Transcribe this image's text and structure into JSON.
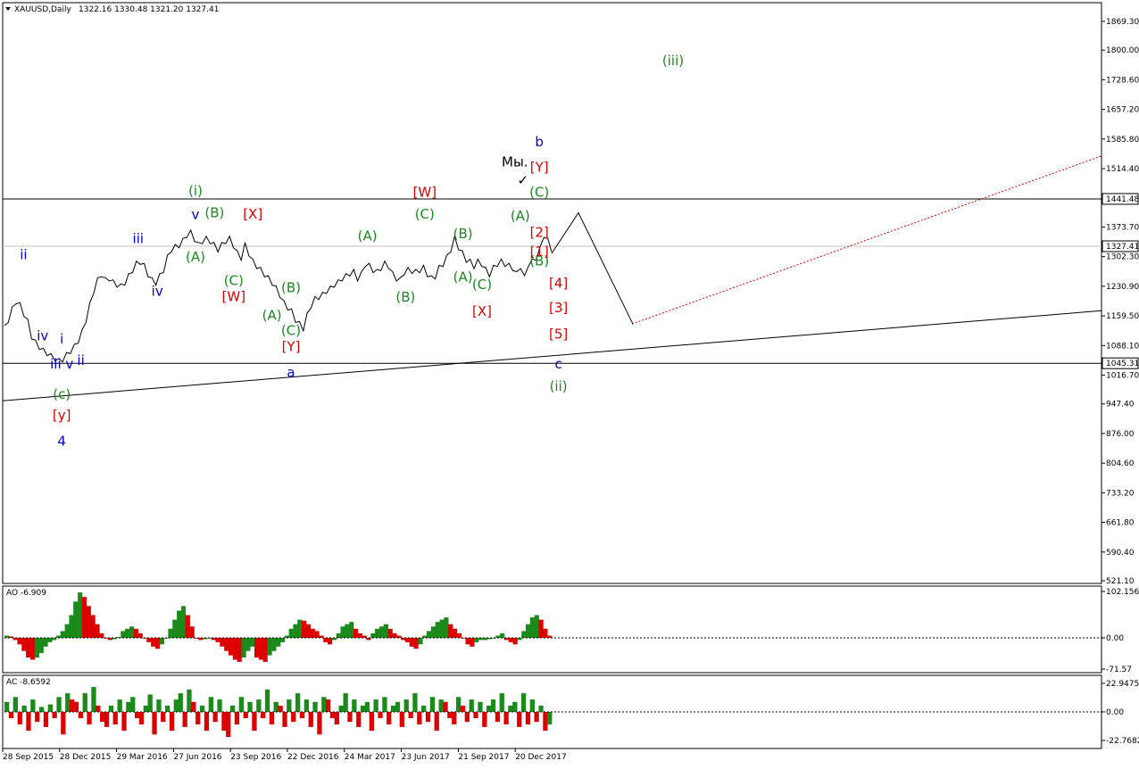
{
  "chart_data": {
    "type": "line",
    "header": {
      "symbol": "XAUUSD,Daily",
      "ohlc": "1322.16 1330.48 1321.20 1327.41"
    },
    "price_axis": {
      "ticks": [
        "1869.30",
        "1800.00",
        "1728.60",
        "1657.20",
        "1585.80",
        "1514.40",
        "1441.48",
        "1373.70",
        "1327.41",
        "1302.30",
        "1230.90",
        "1159.50",
        "1088.10",
        "1045.31",
        "1016.70",
        "947.40",
        "876.00",
        "804.60",
        "733.20",
        "661.80",
        "590.40",
        "521.10"
      ],
      "ylim": [
        521.1,
        1869.3
      ]
    },
    "time_axis": {
      "ticks": [
        "28 Sep 2015",
        "28 Dec 2015",
        "29 Mar 2016",
        "27 Jun 2016",
        "23 Sep 2016",
        "22 Dec 2016",
        "24 Mar 2017",
        "23 Jun 2017",
        "21 Sep 2017",
        "20 Dec 2017"
      ]
    },
    "price_series": {
      "name": "",
      "values": [
        1130,
        1150,
        1175,
        1195,
        1185,
        1165,
        1145,
        1110,
        1095,
        1085,
        1075,
        1070,
        1062,
        1058,
        1050,
        1055,
        1065,
        1075,
        1085,
        1100,
        1120,
        1150,
        1185,
        1220,
        1245,
        1260,
        1245,
        1250,
        1240,
        1235,
        1230,
        1240,
        1255,
        1270,
        1285,
        1290,
        1280,
        1260,
        1245,
        1240,
        1255,
        1270,
        1300,
        1320,
        1325,
        1330,
        1340,
        1355,
        1360,
        1345,
        1330,
        1340,
        1345,
        1340,
        1330,
        1320,
        1330,
        1340,
        1345,
        1330,
        1310,
        1300,
        1330,
        1310,
        1290,
        1280,
        1270,
        1260,
        1250,
        1240,
        1225,
        1210,
        1190,
        1180,
        1170,
        1150,
        1140,
        1130,
        1160,
        1185,
        1200,
        1205,
        1210,
        1220,
        1225,
        1235,
        1240,
        1250,
        1255,
        1262,
        1265,
        1250,
        1260,
        1285,
        1280,
        1270,
        1265,
        1275,
        1285,
        1280,
        1260,
        1250,
        1245,
        1265,
        1270,
        1268,
        1265,
        1270,
        1275,
        1260,
        1250,
        1255,
        1275,
        1285,
        1300,
        1320,
        1345,
        1325,
        1310,
        1295,
        1290,
        1280,
        1290,
        1285,
        1270,
        1260,
        1275,
        1285,
        1290,
        1285,
        1280,
        1275,
        1260,
        1280,
        1250,
        1285,
        1290,
        1300,
        1320,
        1355,
        1340,
        1320
      ],
      "stroke": "#000000"
    },
    "overlay_lines": {
      "resistance_level": 1441.48,
      "support_level": 1045.31,
      "current_price_level": 1327.41,
      "trendline": [
        {
          "date": "Sep 2015",
          "price": 955
        },
        {
          "date": "Jan 2019",
          "price": 1172
        }
      ],
      "dotted_projection": [
        {
          "date": "Feb 2018",
          "price": 1140
        },
        {
          "date": "Jan 2019",
          "price": 1545
        }
      ],
      "forecast_path": [
        {
          "date": "Dec 2017",
          "price": 1310
        },
        {
          "date": "Jan 2018",
          "price": 1408
        },
        {
          "date": "Feb 2018",
          "price": 1140
        }
      ]
    },
    "wave_labels": [
      {
        "text": "ii",
        "color": "#0000cc",
        "date": "Oct 2015",
        "price": 1306
      },
      {
        "text": "iv",
        "color": "#0000cc",
        "date": "Nov 2015",
        "price": 1110
      },
      {
        "text": "i",
        "color": "#0000cc",
        "date": "Dec 2015",
        "price": 1103
      },
      {
        "text": "iii v",
        "color": "#0000cc",
        "date": "Dec 2015",
        "price": 1042
      },
      {
        "text": "ii",
        "color": "#0000cc",
        "date": "Jan 2016",
        "price": 1051
      },
      {
        "text": "(c)",
        "color": "#1a8a1a",
        "date": "Dec 2015",
        "price": 969
      },
      {
        "text": "[y]",
        "color": "#dd0000",
        "date": "Dec 2015",
        "price": 919
      },
      {
        "text": "4",
        "color": "#0000cc",
        "date": "Dec 2015",
        "price": 856
      },
      {
        "text": "iii",
        "color": "#0000cc",
        "date": "Apr 2016",
        "price": 1345
      },
      {
        "text": "iv",
        "color": "#0000cc",
        "date": "May 2016",
        "price": 1218
      },
      {
        "text": "v",
        "color": "#0000cc",
        "date": "Jul 2016",
        "price": 1403
      },
      {
        "text": "(i)",
        "color": "#1a8a1a",
        "date": "Jul 2016",
        "price": 1460
      },
      {
        "text": "(A)",
        "color": "#1a8a1a",
        "date": "Jul 2016",
        "price": 1301
      },
      {
        "text": "(B)",
        "color": "#1a8a1a",
        "date": "Aug 2016",
        "price": 1407
      },
      {
        "text": "(C)",
        "color": "#1a8a1a",
        "date": "Sep 2016",
        "price": 1244
      },
      {
        "text": "[W]",
        "color": "#dd0000",
        "date": "Sep 2016",
        "price": 1205
      },
      {
        "text": "[X]",
        "color": "#dd0000",
        "date": "Oct 2016",
        "price": 1404
      },
      {
        "text": "(A)",
        "color": "#1a8a1a",
        "date": "Nov 2016",
        "price": 1160
      },
      {
        "text": "(B)",
        "color": "#1a8a1a",
        "date": "Dec 2016",
        "price": 1226
      },
      {
        "text": "(C)",
        "color": "#1a8a1a",
        "date": "Dec 2016",
        "price": 1123
      },
      {
        "text": "[Y]",
        "color": "#dd0000",
        "date": "Dec 2016",
        "price": 1084
      },
      {
        "text": "a",
        "color": "#0000cc",
        "date": "Dec 2016",
        "price": 1022
      },
      {
        "text": "(A)",
        "color": "#1a8a1a",
        "date": "Apr 2017",
        "price": 1351
      },
      {
        "text": "(B)",
        "color": "#1a8a1a",
        "date": "Jun 2017",
        "price": 1204
      },
      {
        "text": "[W]",
        "color": "#dd0000",
        "date": "Jul 2017",
        "price": 1456
      },
      {
        "text": "(C)",
        "color": "#1a8a1a",
        "date": "Jul 2017",
        "price": 1404
      },
      {
        "text": "(B)",
        "color": "#1a8a1a",
        "date": "Sep 2017",
        "price": 1357
      },
      {
        "text": "(A)",
        "color": "#1a8a1a",
        "date": "Sep 2017",
        "price": 1252
      },
      {
        "text": "(C)",
        "color": "#1a8a1a",
        "date": "Oct 2017",
        "price": 1234
      },
      {
        "text": "[X]",
        "color": "#dd0000",
        "date": "Oct 2017",
        "price": 1169
      },
      {
        "text": "(A)",
        "color": "#1a8a1a",
        "date": "Dec 2017",
        "price": 1399
      },
      {
        "text": "(B)",
        "color": "#1a8a1a",
        "date": "Jan 2018",
        "price": 1291
      },
      {
        "text": "(C)",
        "color": "#1a8a1a",
        "date": "Jan 2018",
        "price": 1456
      },
      {
        "text": "[Y]",
        "color": "#dd0000",
        "date": "Jan 2018",
        "price": 1517
      },
      {
        "text": "b",
        "color": "#0000cc",
        "date": "Jan 2018",
        "price": 1578
      },
      {
        "text": "[1]",
        "color": "#dd0000",
        "date": "Jan 2018",
        "price": 1314
      },
      {
        "text": "[2]",
        "color": "#dd0000",
        "date": "Jan 2018",
        "price": 1360
      },
      {
        "text": "[3]",
        "color": "#dd0000",
        "date": "Feb 2018",
        "price": 1178
      },
      {
        "text": "[4]",
        "color": "#dd0000",
        "date": "Feb 2018",
        "price": 1237
      },
      {
        "text": "[5]",
        "color": "#dd0000",
        "date": "Feb 2018",
        "price": 1115
      },
      {
        "text": "c",
        "color": "#0000cc",
        "date": "Feb 2018",
        "price": 1042
      },
      {
        "text": "(ii)",
        "color": "#1a8a1a",
        "date": "Feb 2018",
        "price": 989
      },
      {
        "text": "(iii)",
        "color": "#1a8a1a",
        "date": "Aug 2018",
        "price": 1774
      }
    ],
    "annotations": [
      {
        "text": "Мы.",
        "color": "#000000",
        "date": "Dec 2017",
        "price": 1530
      },
      {
        "text": "✓",
        "color": "#000000",
        "date": "Dec 2017",
        "price": 1486
      }
    ],
    "ao": {
      "label": "AO -6.909",
      "ticks": [
        "102.156",
        "0.00",
        "-71.57"
      ],
      "ylim": [
        -71.57,
        102.156
      ],
      "values": [
        5,
        3,
        -5,
        -15,
        -30,
        -45,
        -50,
        -45,
        -35,
        -20,
        -10,
        -5,
        5,
        15,
        30,
        50,
        80,
        100,
        90,
        70,
        50,
        30,
        10,
        0,
        -5,
        -3,
        2,
        15,
        20,
        25,
        20,
        10,
        0,
        -10,
        -20,
        -25,
        -15,
        0,
        20,
        40,
        60,
        70,
        50,
        25,
        0,
        -5,
        -3,
        0,
        -5,
        -10,
        -20,
        -30,
        -40,
        -50,
        -55,
        -45,
        -30,
        -20,
        -45,
        -50,
        -55,
        -40,
        -30,
        -20,
        -10,
        5,
        20,
        30,
        40,
        38,
        30,
        20,
        15,
        5,
        -10,
        -15,
        -5,
        10,
        25,
        30,
        35,
        20,
        10,
        5,
        -5,
        10,
        20,
        25,
        30,
        20,
        10,
        5,
        -5,
        -10,
        -20,
        -25,
        -15,
        5,
        15,
        25,
        35,
        40,
        45,
        30,
        20,
        10,
        0,
        -15,
        -20,
        -10,
        -5,
        -5,
        -3,
        0,
        5,
        10,
        -5,
        -10,
        -15,
        -5,
        15,
        30,
        45,
        50,
        40,
        20,
        5
      ]
    },
    "ac": {
      "label": "AC -8.6592",
      "ticks": [
        "22.9475",
        "0.00",
        "-22.7682"
      ],
      "ylim": [
        -22.7682,
        22.9475
      ],
      "values": [
        8,
        -5,
        12,
        -10,
        5,
        -15,
        10,
        -8,
        4,
        -12,
        6,
        -5,
        12,
        -18,
        15,
        10,
        8,
        -5,
        15,
        -10,
        20,
        5,
        -8,
        -12,
        5,
        -10,
        10,
        -15,
        8,
        12,
        -5,
        -10,
        5,
        14,
        -18,
        10,
        -8,
        5,
        -15,
        10,
        15,
        -12,
        18,
        8,
        -10,
        5,
        -15,
        12,
        -8,
        10,
        -15,
        -20,
        5,
        -10,
        12,
        -5,
        8,
        -15,
        10,
        -5,
        18,
        -10,
        8,
        5,
        -12,
        10,
        -8,
        15,
        -5,
        10,
        -12,
        8,
        -18,
        12,
        10,
        -5,
        -10,
        5,
        15,
        -8,
        10,
        -12,
        5,
        8,
        -15,
        10,
        -5,
        12,
        -10,
        5,
        8,
        -12,
        10,
        -5,
        15,
        -10,
        5,
        -8,
        12,
        -15,
        10,
        8,
        -5,
        -10,
        12,
        5,
        -8,
        10,
        -5,
        8,
        -12,
        5,
        10,
        -8,
        15,
        -10,
        5,
        8,
        -12,
        15,
        -10,
        10,
        -8,
        5,
        -15,
        -10
      ]
    },
    "colors": {
      "price_line": "#000000",
      "up_bar": "#1a8a1a",
      "down_bar": "#dd0000",
      "projection": "#dd0000",
      "wave_blue": "#0000cc",
      "wave_green": "#1a8a1a",
      "wave_red": "#dd0000"
    }
  }
}
